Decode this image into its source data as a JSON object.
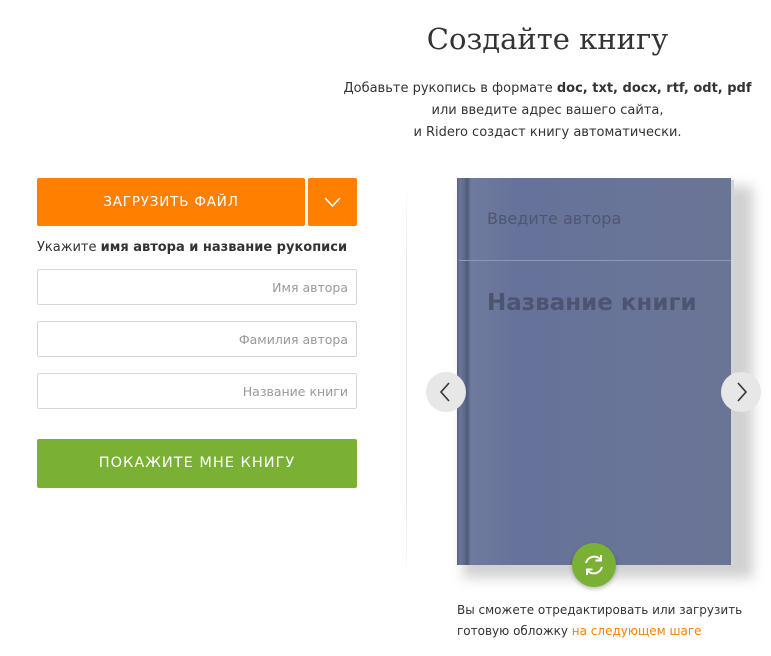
{
  "header": {
    "title": "Создайте книгу",
    "subtitle_prefix": "Добавьте рукопись в формате ",
    "subtitle_formats": "doc, txt, docx, rtf, odt, pdf",
    "subtitle_line2": "или введите адрес вашего сайта,",
    "subtitle_line3": "и Ridero создаст книгу автоматически."
  },
  "upload": {
    "button_label": "ЗАГРУЗИТЬ ФАЙЛ",
    "dropdown_icon": "chevron-down-icon"
  },
  "form": {
    "hint_prefix": "Укажите ",
    "hint_bold": "имя автора и название рукописи",
    "first_name_placeholder": "Имя автора",
    "last_name_placeholder": "Фамилия автора",
    "book_title_placeholder": "Название книги",
    "submit_label": "ПОКАЖИТЕ МНЕ КНИГУ"
  },
  "cover": {
    "author_placeholder": "Введите автора",
    "title_placeholder": "Название книги",
    "prev_icon": "chevron-left-icon",
    "next_icon": "chevron-right-icon",
    "refresh_icon": "refresh-icon"
  },
  "note": {
    "text_line1": "Вы сможете отредактировать или загрузить",
    "text_line2": "готовую обложку ",
    "link": "на следующем шаге"
  },
  "colors": {
    "accent_orange": "#ff7f00",
    "accent_green": "#7ab135",
    "cover_blue": "#6a7596"
  }
}
